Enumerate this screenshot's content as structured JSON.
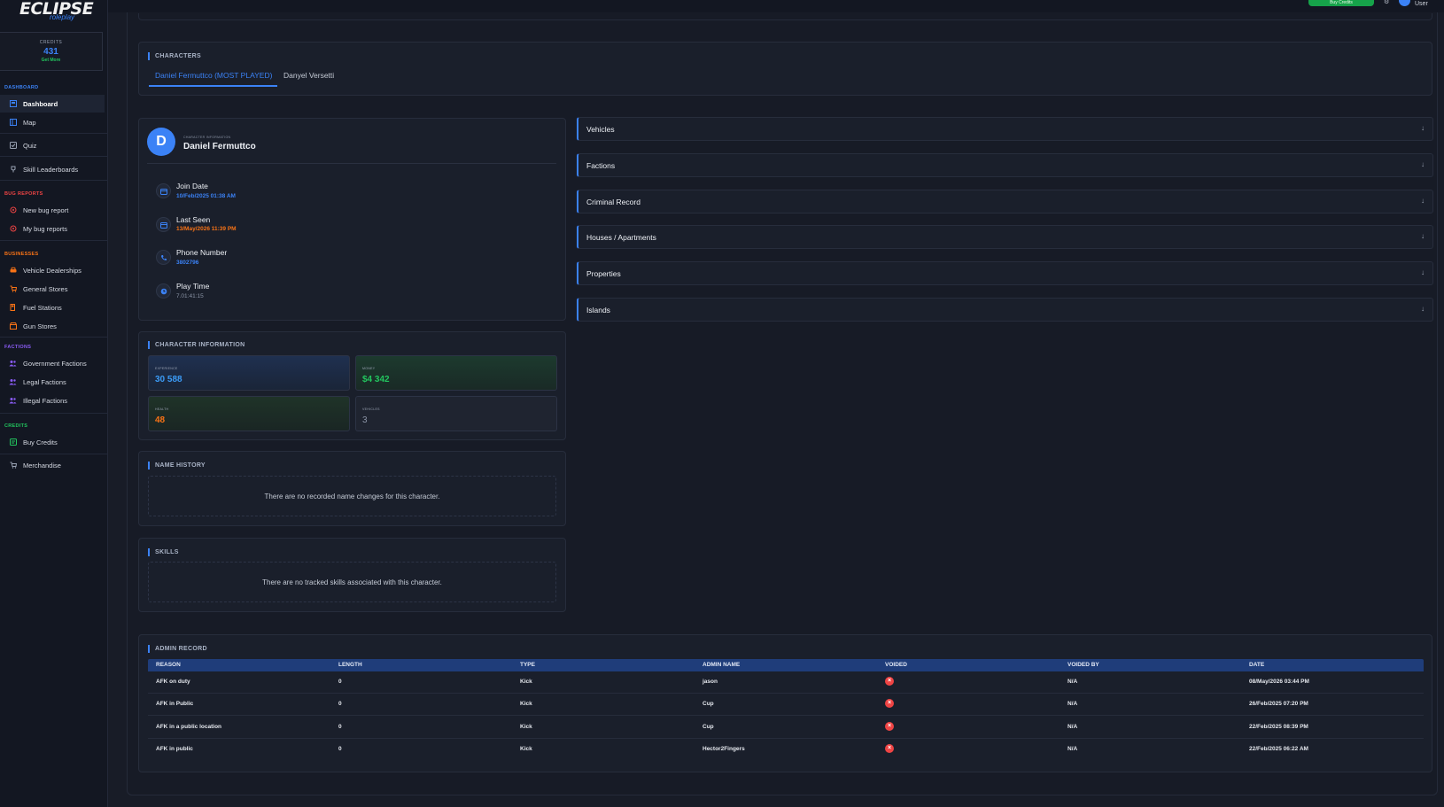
{
  "brand": {
    "logo_main": "ECLIPSE",
    "logo_sub": "roleplay"
  },
  "credits": {
    "label": "CREDITS",
    "value": "431",
    "cta": "Get More"
  },
  "sidebar": {
    "sections": [
      {
        "label": "DASHBOARD",
        "color": "#3b82f6"
      },
      {
        "label": "BUG REPORTS",
        "color": "#ef4444"
      },
      {
        "label": "BUSINESSES",
        "color": "#f97316"
      },
      {
        "label": "FACTIONS",
        "color": "#8b5cf6"
      },
      {
        "label": "CREDITS",
        "color": "#22c55e"
      }
    ],
    "items": [
      {
        "label": "Dashboard",
        "icon": "dashboard-icon"
      },
      {
        "label": "Map",
        "icon": "map-icon"
      },
      {
        "label": "Quiz",
        "icon": "quiz-icon"
      },
      {
        "label": "Skill Leaderboards",
        "icon": "trophy-icon"
      },
      {
        "label": "New bug report",
        "icon": "bug-icon"
      },
      {
        "label": "My bug reports",
        "icon": "bug-icon"
      },
      {
        "label": "Vehicle Dealerships",
        "icon": "car-icon"
      },
      {
        "label": "General Stores",
        "icon": "cart-icon"
      },
      {
        "label": "Fuel Stations",
        "icon": "fuel-icon"
      },
      {
        "label": "Gun Stores",
        "icon": "store-icon"
      },
      {
        "label": "Government Factions",
        "icon": "people-icon"
      },
      {
        "label": "Legal Factions",
        "icon": "people-icon"
      },
      {
        "label": "Illegal Factions",
        "icon": "people-icon"
      },
      {
        "label": "Buy Credits",
        "icon": "credit-icon"
      },
      {
        "label": "Merchandise",
        "icon": "cart-icon"
      }
    ]
  },
  "topbar": {
    "buy_label": "Buy Credits",
    "user_label": "User"
  },
  "characters": {
    "title": "CHARACTERS",
    "tabs": [
      {
        "label": "Daniel Fermuttco (MOST PLAYED)",
        "active": true
      },
      {
        "label": "Danyel Versetti",
        "active": false
      }
    ]
  },
  "profile": {
    "avatar_letter": "D",
    "small_label": "CHARACTER INFORMATION",
    "name": "Daniel Fermuttco",
    "fields": [
      {
        "label": "Join Date",
        "value": "10/Feb/2025 01:38 AM",
        "color": "#3b82f6",
        "icon": "calendar-icon"
      },
      {
        "label": "Last Seen",
        "value": "13/May/2026 11:39 PM",
        "color": "#f97316",
        "icon": "calendar-icon"
      },
      {
        "label": "Phone Number",
        "value": "3802796",
        "color": "#3b82f6",
        "icon": "phone-icon"
      },
      {
        "label": "Play Time",
        "value": "7.01:41:15",
        "color": "#8b94a6",
        "icon": "clock-icon"
      }
    ]
  },
  "char_info": {
    "title": "CHARACTER INFORMATION",
    "stats": [
      {
        "label": "EXPERIENCE",
        "value": "30 588",
        "color": "#3b9bf6"
      },
      {
        "label": "MONEY",
        "value": "$4 342",
        "color": "#22c55e"
      },
      {
        "label": "HEALTH",
        "value": "48",
        "color": "#f97316"
      },
      {
        "label": "VEHICLES",
        "value": "3",
        "color": "#8b94a6"
      }
    ]
  },
  "name_history": {
    "title": "NAME HISTORY",
    "empty": "There are no recorded name changes for this character."
  },
  "skills": {
    "title": "SKILLS",
    "empty": "There are no tracked skills associated with this character."
  },
  "accordions": [
    {
      "label": "Vehicles"
    },
    {
      "label": "Factions"
    },
    {
      "label": "Criminal Record"
    },
    {
      "label": "Houses / Apartments"
    },
    {
      "label": "Properties"
    },
    {
      "label": "Islands"
    }
  ],
  "admin_record": {
    "title": "ADMIN RECORD",
    "columns": [
      "REASON",
      "LENGTH",
      "TYPE",
      "ADMIN NAME",
      "VOIDED",
      "VOIDED BY",
      "DATE"
    ],
    "rows": [
      {
        "reason": "AFK on duty",
        "length": "0",
        "type": "Kick",
        "admin": "jason",
        "voided_by": "N/A",
        "date": "08/May/2026 03:44 PM"
      },
      {
        "reason": "AFK in Public",
        "length": "0",
        "type": "Kick",
        "admin": "Cup",
        "voided_by": "N/A",
        "date": "26/Feb/2025 07:20 PM"
      },
      {
        "reason": "AFK in a public location",
        "length": "0",
        "type": "Kick",
        "admin": "Cup",
        "voided_by": "N/A",
        "date": "22/Feb/2025 08:39 PM"
      },
      {
        "reason": "AFK in public",
        "length": "0",
        "type": "Kick",
        "admin": "Hector2Fingers",
        "voided_by": "N/A",
        "date": "22/Feb/2025 06:22 AM"
      }
    ]
  }
}
